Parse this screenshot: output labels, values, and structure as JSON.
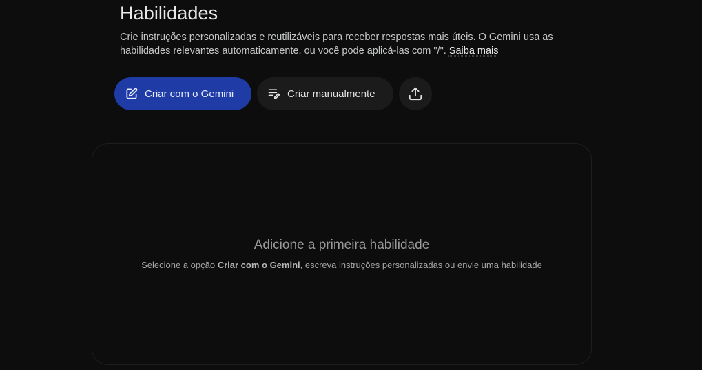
{
  "header": {
    "title": "Habilidades",
    "description": "Crie instruções personalizadas e reutilizáveis para receber respostas mais úteis. O Gemini usa as habilidades relevantes automaticamente, ou você pode aplicá-las com \"/\".",
    "learn_more_label": "Saiba mais"
  },
  "actions": {
    "create_with_gemini": {
      "label": "Criar com o Gemini",
      "icon": "edit-square-icon"
    },
    "create_manually": {
      "label": "Criar manualmente",
      "icon": "edit-note-icon"
    },
    "upload": {
      "icon": "upload-icon"
    }
  },
  "empty_state": {
    "title": "Adicione a primeira habilidade",
    "text_prefix": "Selecione a opção",
    "text_emphasis": "Criar com o Gemini",
    "text_suffix": ", escreva instruções personalizadas ou envie uma habilidade"
  },
  "colors": {
    "background": "#0d0d0d",
    "primary_button": "#1f3ba5",
    "secondary_button": "#1b1b1b"
  }
}
